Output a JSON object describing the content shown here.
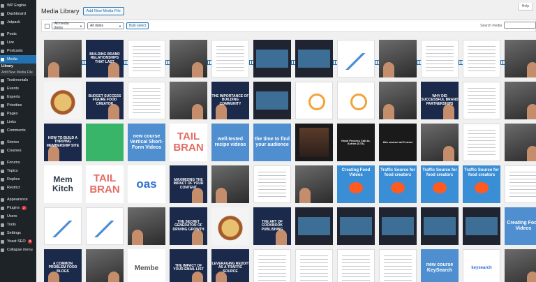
{
  "sidebar": {
    "items": [
      {
        "label": "WP Engine",
        "icon": "wp-engine-icon"
      },
      {
        "label": "Dashboard",
        "icon": "dashboard-icon"
      },
      {
        "label": "Jetpack",
        "icon": "jetpack-icon"
      },
      {
        "label": "Posts",
        "icon": "pin-icon"
      },
      {
        "label": "Live",
        "icon": "live-icon"
      },
      {
        "label": "Podcasts",
        "icon": "microphone-icon"
      },
      {
        "label": "Media",
        "icon": "media-icon",
        "active": true
      }
    ],
    "media_sub": [
      "Library",
      "Add New Media File"
    ],
    "items2": [
      {
        "label": "Testimonials",
        "icon": "quote-icon"
      },
      {
        "label": "Events",
        "icon": "calendar-icon"
      },
      {
        "label": "Experts",
        "icon": "user-icon"
      },
      {
        "label": "Priorities",
        "icon": "star-icon"
      },
      {
        "label": "Pages",
        "icon": "page-icon"
      },
      {
        "label": "Links",
        "icon": "link-icon"
      },
      {
        "label": "Comments",
        "icon": "comment-icon"
      },
      {
        "label": "Stories",
        "icon": "stories-icon"
      },
      {
        "label": "Courses",
        "icon": "course-icon"
      },
      {
        "label": "Forums",
        "icon": "forum-icon"
      },
      {
        "label": "Topics",
        "icon": "topic-icon"
      },
      {
        "label": "Replies",
        "icon": "reply-icon"
      },
      {
        "label": "Restrict",
        "icon": "lock-icon"
      },
      {
        "label": "Appearance",
        "icon": "brush-icon"
      },
      {
        "label": "Plugins",
        "icon": "plugin-icon",
        "badge": "2"
      },
      {
        "label": "Users",
        "icon": "users-icon"
      },
      {
        "label": "Tools",
        "icon": "wrench-icon"
      },
      {
        "label": "Settings",
        "icon": "gear-icon"
      },
      {
        "label": "Yoast SEO",
        "icon": "yoast-icon",
        "badge": "2"
      },
      {
        "label": "Collapse menu",
        "icon": "collapse-icon"
      }
    ]
  },
  "header": {
    "title": "Media Library",
    "add_button": "Add New Media File",
    "help": "Help"
  },
  "toolbar": {
    "filter_items": "All media items",
    "filter_dates": "All dates",
    "bulk_select": "Bulk select",
    "search_label": "Search media"
  },
  "thumbnails": [
    {
      "type": "photo",
      "text": ""
    },
    {
      "type": "navy",
      "text": "BUILDING BRAND RELATIONSHIPS THAT LAST"
    },
    {
      "type": "doc",
      "text": ""
    },
    {
      "type": "photo",
      "text": ""
    },
    {
      "type": "doc",
      "text": ""
    },
    {
      "type": "meeting",
      "text": ""
    },
    {
      "type": "meeting",
      "text": ""
    },
    {
      "type": "chart",
      "text": ""
    },
    {
      "type": "photo",
      "text": ""
    },
    {
      "type": "doc",
      "text": ""
    },
    {
      "type": "doc",
      "text": ""
    },
    {
      "type": "photo",
      "text": ""
    },
    {
      "type": "food",
      "text": ""
    },
    {
      "type": "navy",
      "text": "BUDGET SUCCESS FIGURE FOOD CREATOR"
    },
    {
      "type": "doc",
      "text": ""
    },
    {
      "type": "photo",
      "text": ""
    },
    {
      "type": "navy",
      "text": "THE IMPORTANCE OF BUILDING COMMUNITY"
    },
    {
      "type": "meeting",
      "text": ""
    },
    {
      "type": "circle",
      "text": ""
    },
    {
      "type": "circle",
      "text": ""
    },
    {
      "type": "photo",
      "text": ""
    },
    {
      "type": "navy",
      "text": "WHY DID SUCCESSFUL BRAND PARTNERSHIPS"
    },
    {
      "type": "doc",
      "text": ""
    },
    {
      "type": "photo",
      "text": ""
    },
    {
      "type": "navy",
      "text": "HOW TO BUILD A THRIVING MEMBERSHIP SITE"
    },
    {
      "type": "green",
      "text": ""
    },
    {
      "type": "blue",
      "text": "new course Vertical Short-Form Videos"
    },
    {
      "type": "brand",
      "text": "TAIL BRAN"
    },
    {
      "type": "blue",
      "text": "well-tested recipe videos"
    },
    {
      "type": "blue",
      "text": "the time to find your audience"
    },
    {
      "type": "video",
      "text": ""
    },
    {
      "type": "blacktxt",
      "text": "Hook Process Call-to-Action (CTA)"
    },
    {
      "type": "blacktxt",
      "text": "this course we'll cover"
    },
    {
      "type": "photo",
      "text": ""
    },
    {
      "type": "doc",
      "text": ""
    },
    {
      "type": "photo",
      "text": ""
    },
    {
      "type": "brand2",
      "text": "Mem Kitch"
    },
    {
      "type": "brand",
      "text": "TAIL BRAN"
    },
    {
      "type": "brand4",
      "text": "oas"
    },
    {
      "type": "navy",
      "text": "MAXIMIZING THE IMPACT OF YOUR CONTENT"
    },
    {
      "type": "photo",
      "text": ""
    },
    {
      "type": "doc",
      "text": ""
    },
    {
      "type": "photo",
      "text": ""
    },
    {
      "type": "reddit",
      "text": "Creating Food Videos"
    },
    {
      "type": "reddit",
      "text": "Traffic Source for food creators"
    },
    {
      "type": "reddit",
      "text": "Traffic Source for food creators"
    },
    {
      "type": "reddit",
      "text": "Traffic Source for food creators"
    },
    {
      "type": "doc",
      "text": ""
    },
    {
      "type": "chart",
      "text": ""
    },
    {
      "type": "chart",
      "text": ""
    },
    {
      "type": "photo",
      "text": ""
    },
    {
      "type": "navy",
      "text": "THE SECRET GENERATOR OF DRIVING GROWTH"
    },
    {
      "type": "food",
      "text": ""
    },
    {
      "type": "navy",
      "text": "THE ART OF COOKBOOK PUBLISHING"
    },
    {
      "type": "meeting",
      "text": ""
    },
    {
      "type": "meeting",
      "text": ""
    },
    {
      "type": "meeting",
      "text": ""
    },
    {
      "type": "meeting",
      "text": ""
    },
    {
      "type": "meeting",
      "text": ""
    },
    {
      "type": "blue",
      "text": "Creating Food Videos"
    },
    {
      "type": "navy",
      "text": "A COMMON PROBLEM FOOD BLOGS"
    },
    {
      "type": "photo",
      "text": ""
    },
    {
      "type": "brand3",
      "text": "Membe"
    },
    {
      "type": "navy",
      "text": "THE IMPACT OF YOUR EMAIL LIST"
    },
    {
      "type": "navy",
      "text": "LEVERAGING REDDIT AS A TRAFFIC SOURCE"
    },
    {
      "type": "doc",
      "text": ""
    },
    {
      "type": "doc",
      "text": ""
    },
    {
      "type": "doc",
      "text": ""
    },
    {
      "type": "doc",
      "text": ""
    },
    {
      "type": "blue",
      "text": "new course KeySearch"
    },
    {
      "type": "kw",
      "text": "keysearch"
    },
    {
      "type": "photo",
      "text": ""
    }
  ]
}
